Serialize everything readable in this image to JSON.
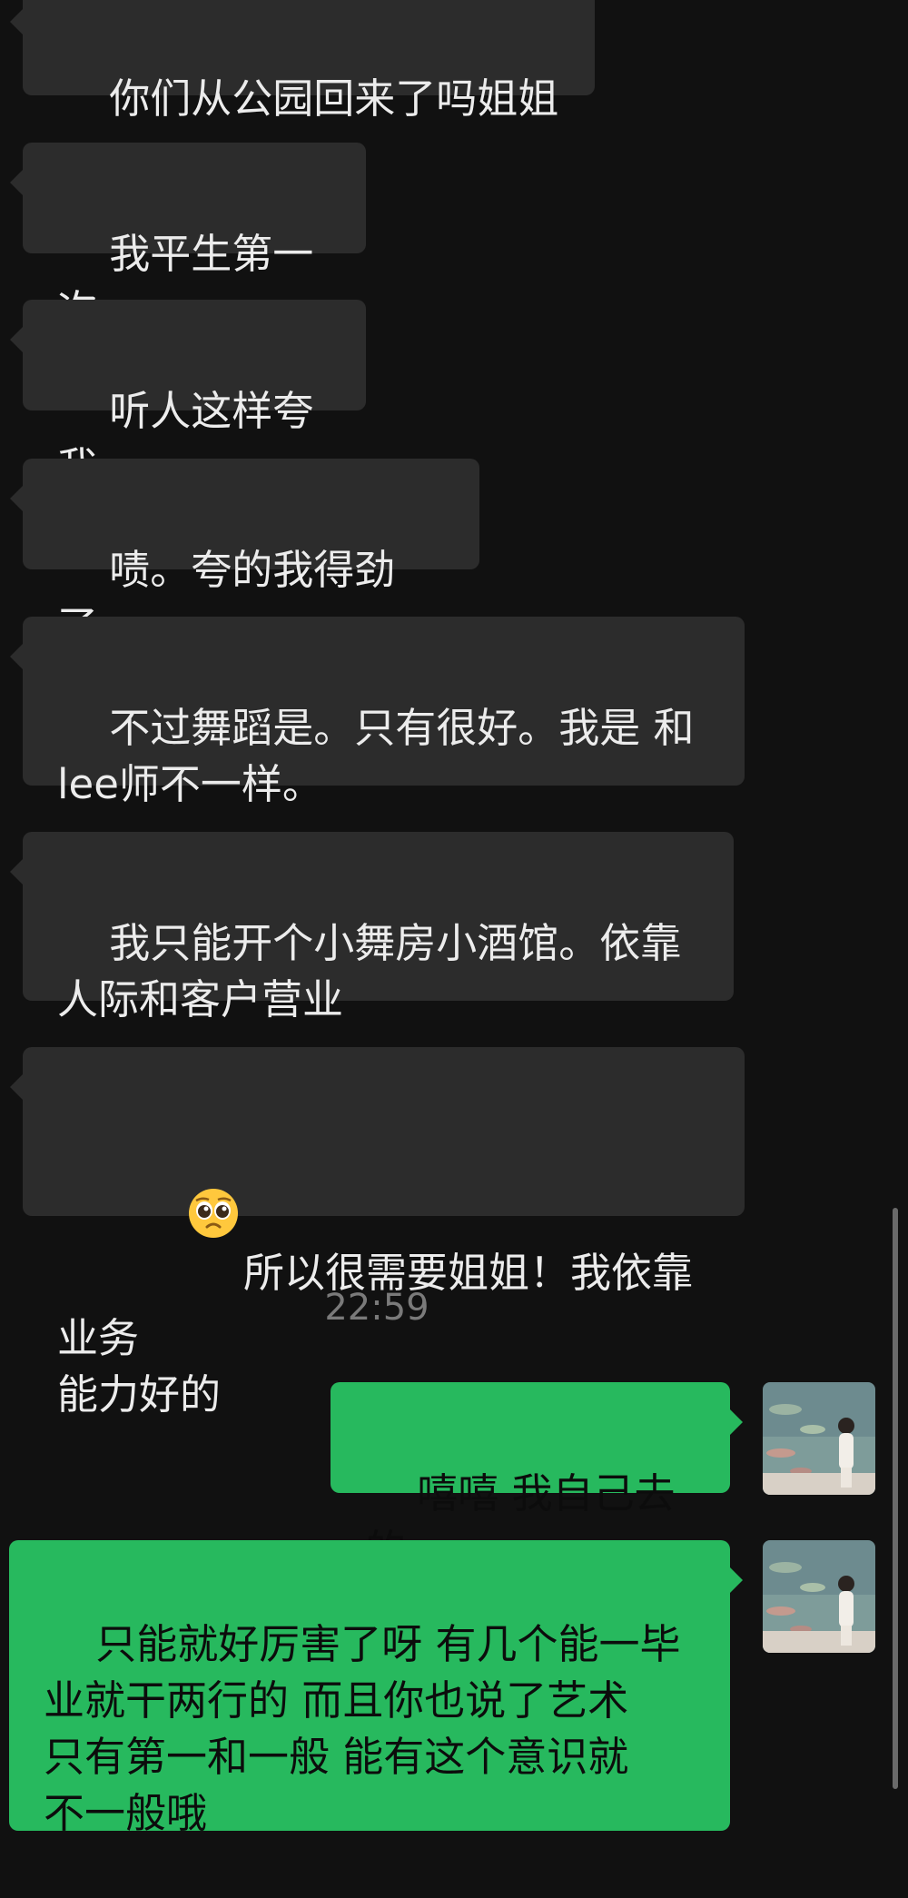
{
  "conversation": {
    "messages": [
      {
        "side": "received",
        "text": "你们从公园回来了吗姐姐"
      },
      {
        "side": "received",
        "text": "我平生第一次"
      },
      {
        "side": "received",
        "text": "听人这样夸我"
      },
      {
        "side": "received",
        "text": "啧。夸的我得劲了。"
      },
      {
        "side": "received",
        "text": "不过舞蹈是。只有很好。我是 和\nlee师不一样。"
      },
      {
        "side": "received",
        "text": "我只能开个小舞房小酒馆。依靠\n人际和客户营业"
      },
      {
        "side": "received",
        "emoji": "pleading-face-emoji",
        "text": "所以很需要姐姐！我依靠业务\n能力好的"
      }
    ],
    "timestamp": "22:59",
    "sent_messages": [
      {
        "side": "sent",
        "text": "嘻嘻 我自己去的"
      },
      {
        "side": "sent",
        "text": "只能就好厉害了呀 有几个能一毕\n业就干两行的 而且你也说了艺术\n只有第一和一般 能有这个意识就\n不一般哦"
      }
    ]
  },
  "colors": {
    "background": "#111111",
    "received_bubble": "#2C2C2C",
    "sent_bubble": "#27B95E",
    "received_text": "#ECECEC",
    "sent_text": "#0C0C0C",
    "timestamp_text": "#7A7A7A"
  },
  "icons": {
    "avatar": "user-avatar-photo",
    "emoji": "pleading-face-emoji"
  }
}
